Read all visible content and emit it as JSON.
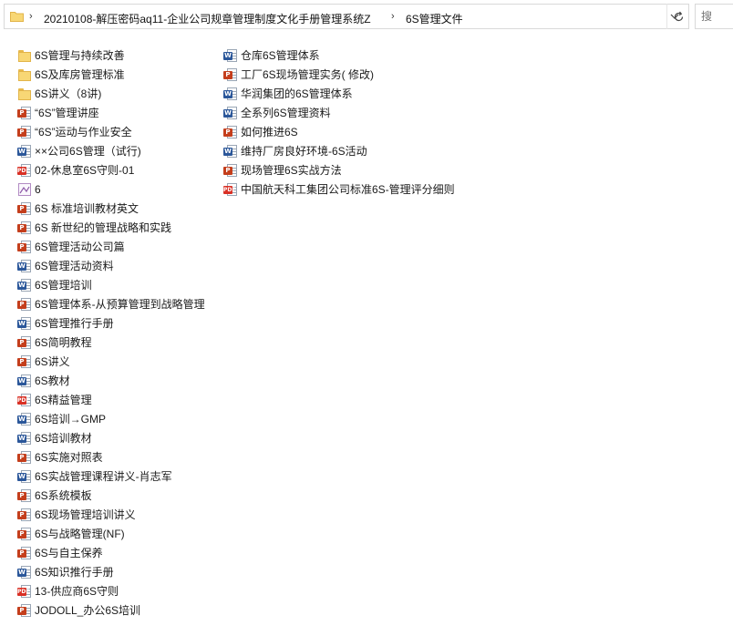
{
  "address_bar": {
    "segments": [
      "20210108-解压密码aq11-企业公司规章管理制度文化手册管理系统Z",
      "6S管理文件"
    ]
  },
  "search": {
    "placeholder": "搜"
  },
  "files": {
    "column1": [
      {
        "name": "6S管理与持续改善",
        "type": "folder"
      },
      {
        "name": "6S及库房管理标准",
        "type": "folder"
      },
      {
        "name": "6S讲义（8讲)",
        "type": "folder"
      },
      {
        "name": "“6S”管理讲座",
        "type": "ppt"
      },
      {
        "name": "“6S”运动与作业安全",
        "type": "ppt"
      },
      {
        "name": "××公司6S管理（试行)",
        "type": "word"
      },
      {
        "name": "02-休息室6S守则-01",
        "type": "pdf"
      },
      {
        "name": "6",
        "type": "image"
      },
      {
        "name": "6S 标准培训教材英文",
        "type": "ppt"
      },
      {
        "name": "6S 新世纪的管理战略和实践",
        "type": "ppt"
      },
      {
        "name": "6S管理活动公司篇",
        "type": "ppt"
      },
      {
        "name": "6S管理活动资料",
        "type": "word"
      },
      {
        "name": "6S管理培训",
        "type": "word"
      },
      {
        "name": "6S管理体系-从预算管理到战略管理",
        "type": "ppt"
      },
      {
        "name": "6S管理推行手册",
        "type": "word"
      },
      {
        "name": "6S简明教程",
        "type": "ppt"
      },
      {
        "name": "6S讲义",
        "type": "ppt"
      },
      {
        "name": "6S教材",
        "type": "word"
      },
      {
        "name": "6S精益管理",
        "type": "pdf"
      },
      {
        "name": "6S培训→GMP",
        "type": "word"
      },
      {
        "name": "6S培训教材",
        "type": "word"
      },
      {
        "name": "6S实施对照表",
        "type": "ppt"
      },
      {
        "name": "6S实战管理课程讲义-肖志军",
        "type": "word"
      },
      {
        "name": "6S系统模板",
        "type": "ppt"
      },
      {
        "name": "6S现场管理培训讲义",
        "type": "ppt"
      },
      {
        "name": "6S与战略管理(NF)",
        "type": "ppt"
      },
      {
        "name": "6S与自主保养",
        "type": "ppt"
      },
      {
        "name": "6S知识推行手册",
        "type": "word"
      },
      {
        "name": "13-供应商6S守则",
        "type": "pdf"
      },
      {
        "name": "JODOLL_办公6S培训",
        "type": "ppt"
      }
    ],
    "column2": [
      {
        "name": "仓库6S管理体系",
        "type": "word"
      },
      {
        "name": "工厂6S现场管理实务( 修改)",
        "type": "ppt"
      },
      {
        "name": "华润集团的6S管理体系",
        "type": "word"
      },
      {
        "name": "全系列6S管理资料",
        "type": "word"
      },
      {
        "name": "如何推进6S",
        "type": "ppt"
      },
      {
        "name": "维持厂房良好环境-6S活动",
        "type": "word"
      },
      {
        "name": "现场管理6S实战方法",
        "type": "ppt"
      },
      {
        "name": "中国航天科工集团公司标准6S-管理评分细则",
        "type": "pdf"
      }
    ]
  },
  "colors": {
    "folder": "#f8d775",
    "word": "#2b579a",
    "ppt": "#c43e1c",
    "pdf": "#d93025",
    "image": "#b38cc4"
  }
}
